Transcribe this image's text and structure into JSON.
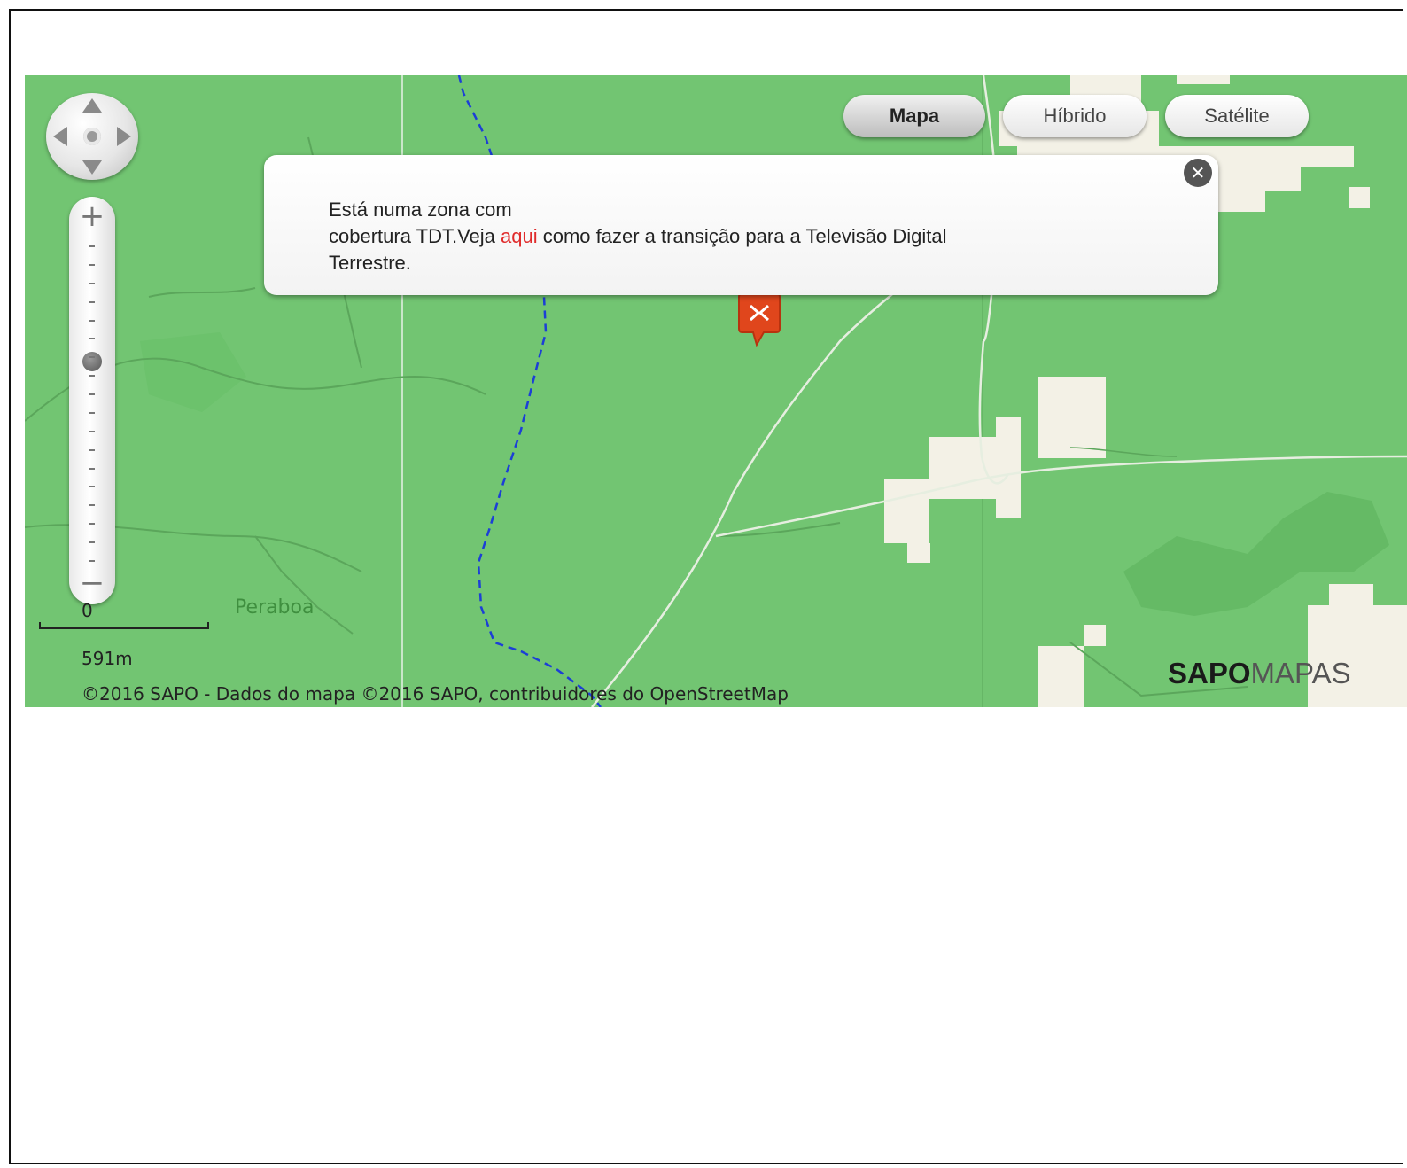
{
  "map_type_buttons": [
    {
      "label": "Mapa",
      "active": true
    },
    {
      "label": "Híbrido",
      "active": false
    },
    {
      "label": "Satélite",
      "active": false
    }
  ],
  "popup": {
    "text_before_link": "Está numa zona com\ncobertura TDT.Veja ",
    "link_text": "aqui",
    "text_after_link": " como fazer a transição para a Televisão Digital\nTerrestre.",
    "close_icon": "close-icon"
  },
  "zoom": {
    "plus_label": "+",
    "minus_label": "−",
    "level_fraction": 0.37
  },
  "scale": {
    "zero_label": "0",
    "distance_label": "591m"
  },
  "place_labels": [
    "Peraboa"
  ],
  "copyright": "©2016 SAPO - Dados do mapa ©2016 SAPO, contribuidores do OpenStreetMap",
  "logo": {
    "bold": "SAPO",
    "light": "MAPAS"
  },
  "colors": {
    "map_green": "#72c572",
    "link_red": "#e02b2b",
    "marker_orange": "#e0461c"
  }
}
